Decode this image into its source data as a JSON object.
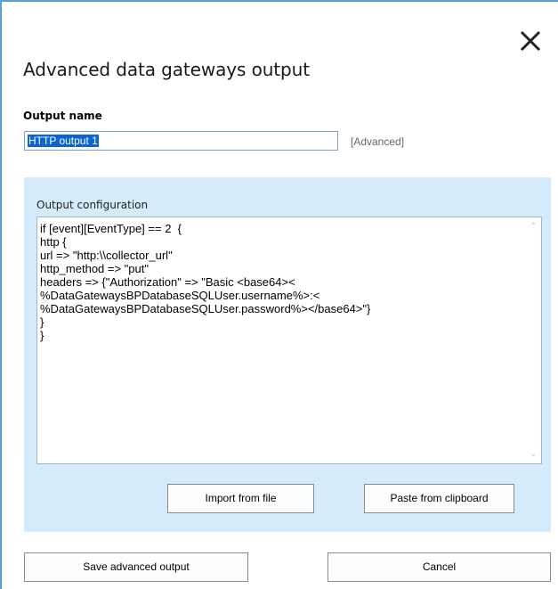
{
  "dialog": {
    "title": "Advanced data gateways output",
    "close_icon": "close-icon"
  },
  "output_name": {
    "label": "Output name",
    "value": "HTTP output 1",
    "advanced_link": "[Advanced]"
  },
  "configuration": {
    "label": "Output configuration",
    "code": "if [event][EventType] == 2  {\nhttp {\nurl => \"http:\\\\collector_url\"\nhttp_method => \"put\"\nheaders => {\"Authorization\" => \"Basic <base64><\n%DataGatewaysBPDatabaseSQLUser.username%>:<\n%DataGatewaysBPDatabaseSQLUser.password%></base64>\"}\n}\n}",
    "import_label": "Import from file",
    "paste_label": "Paste from clipboard"
  },
  "footer": {
    "save_label": "Save advanced output",
    "cancel_label": "Cancel"
  },
  "colors": {
    "panel_background": "#d3ebfa",
    "window_border": "#5aa0d8",
    "selection": "#0a64d6"
  }
}
